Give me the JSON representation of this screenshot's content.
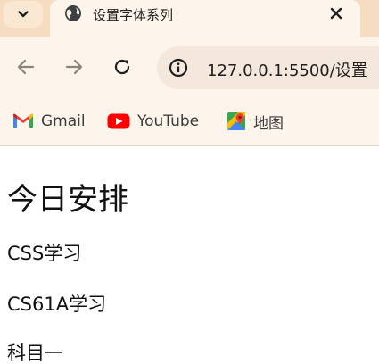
{
  "browser": {
    "tab": {
      "title": "设置字体系列",
      "favicon": "globe-icon"
    },
    "toolbar": {
      "url": "127.0.0.1:5500/设置"
    },
    "bookmarks": [
      {
        "label": "Gmail",
        "icon": "gmail-icon"
      },
      {
        "label": "YouTube",
        "icon": "youtube-icon"
      },
      {
        "label": "地图",
        "icon": "maps-icon"
      }
    ],
    "colors": {
      "tabstrip": "#f6dcc0",
      "toolbar": "#fdf4ec",
      "omnibox": "#f4e7db",
      "youtube_red": "#ff0000"
    }
  },
  "page": {
    "heading": "今日安排",
    "lines": [
      "CSS学习",
      "CS61A学习",
      "科目一"
    ]
  }
}
